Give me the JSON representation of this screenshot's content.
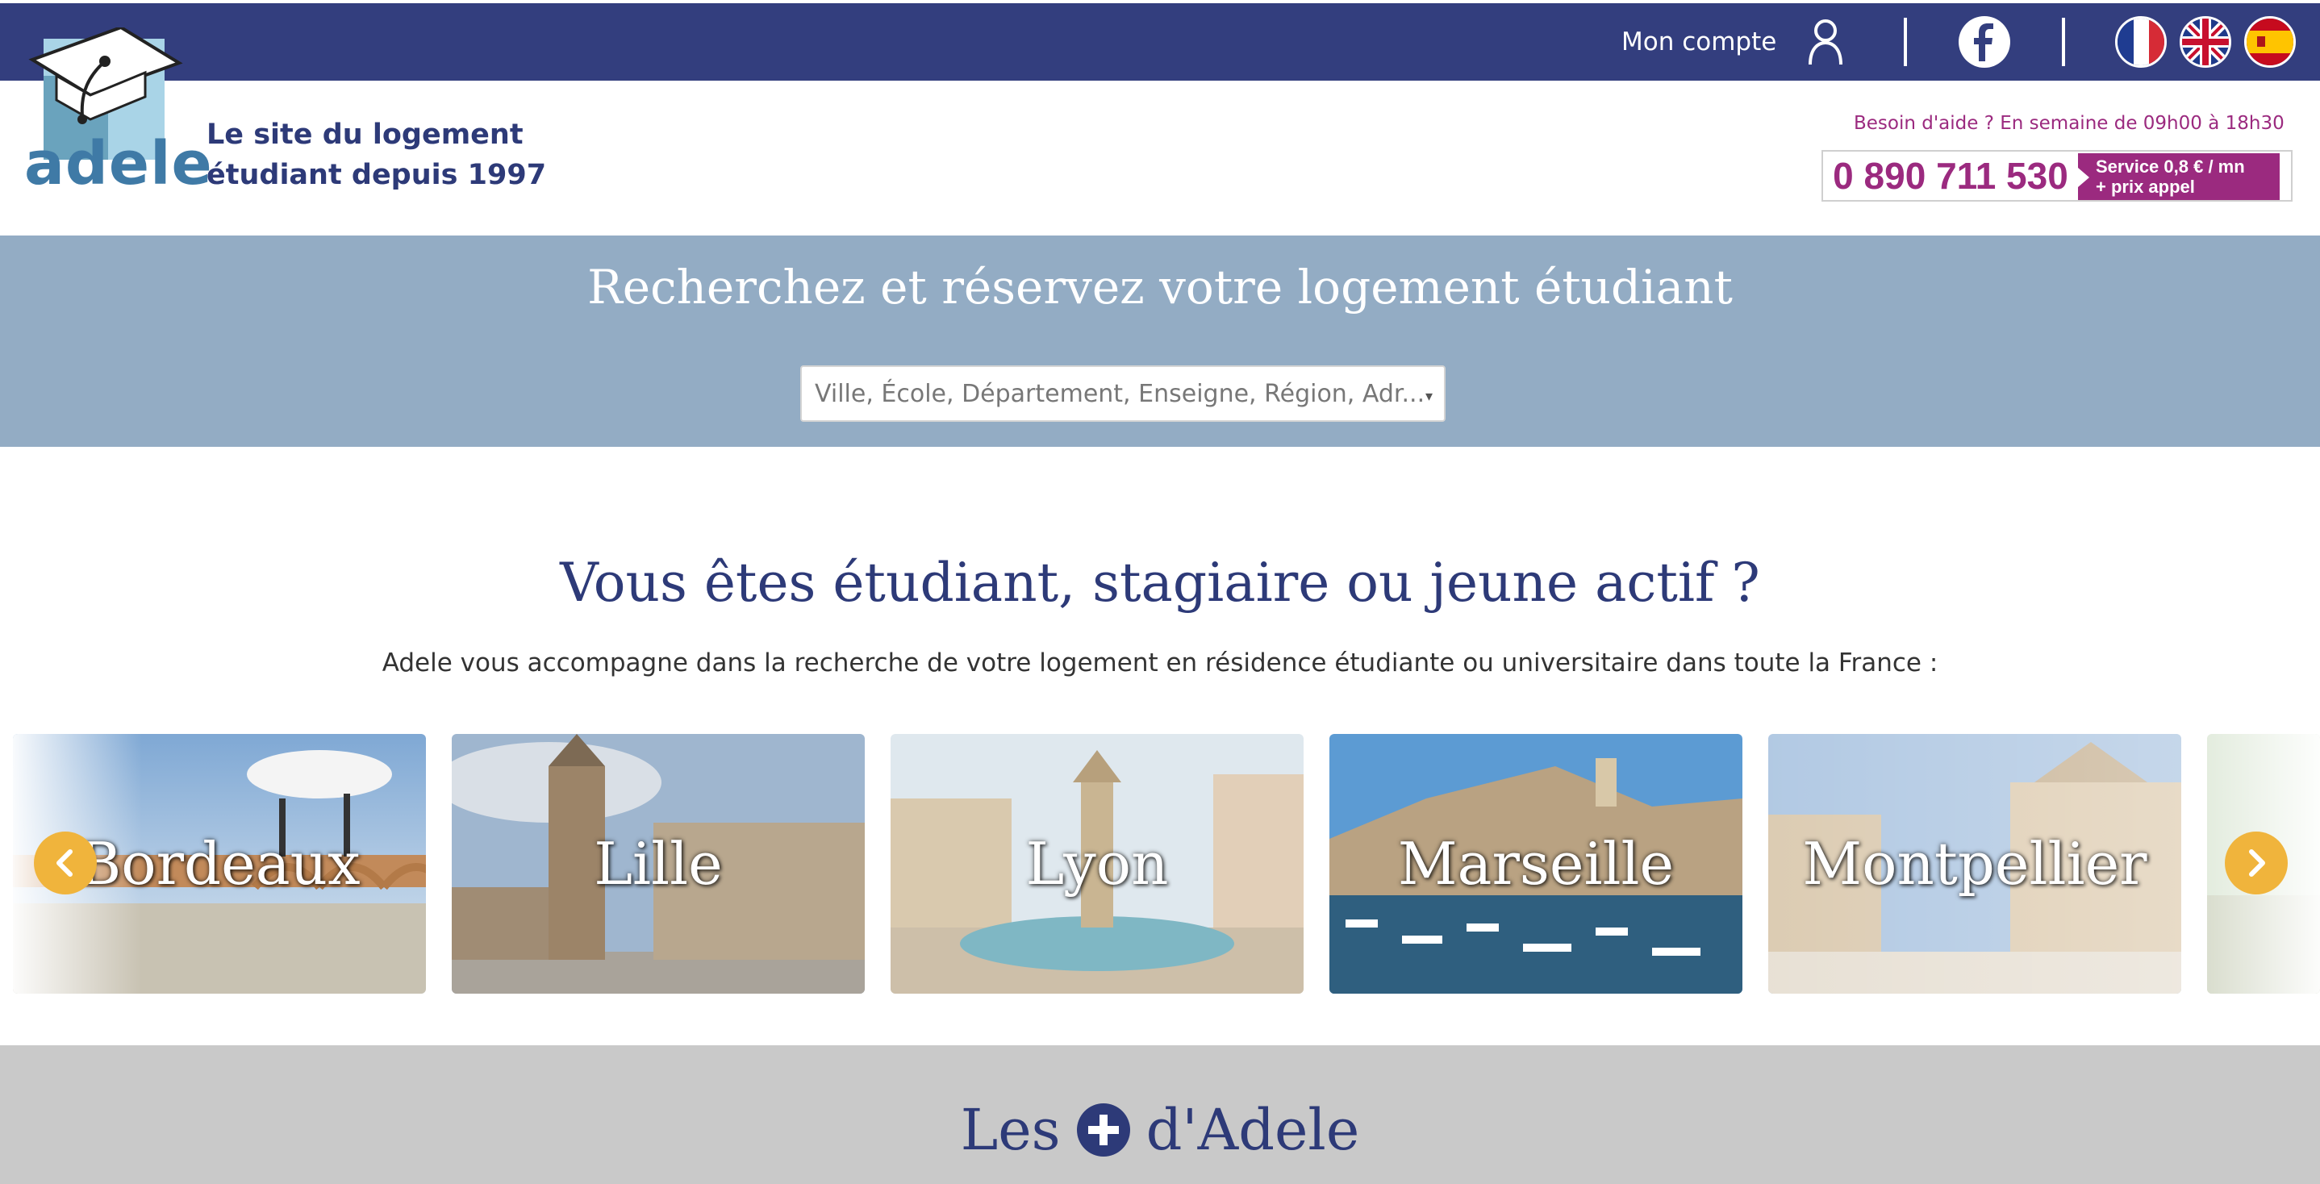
{
  "topbar": {
    "account_label": "Mon compte",
    "icons": [
      "user-icon",
      "facebook-icon",
      "flag-fr-icon",
      "flag-uk-icon",
      "flag-es-icon"
    ],
    "colors": {
      "bar": "#333e7e"
    }
  },
  "header": {
    "logo_text": "adele",
    "tagline_line1": "Le site du logement",
    "tagline_line2": "étudiant depuis 1997",
    "help_text": "Besoin d'aide ? En semaine de 09h00 à 18h30",
    "phone_number": "0 890 711 530",
    "phone_tag_line1": "Service   0,8 € / mn",
    "phone_tag_line2": "+ prix appel",
    "colors": {
      "brand": "#2d3a78",
      "phone": "#9b2a7f"
    }
  },
  "search": {
    "title": "Recherchez et réservez votre logement étudiant",
    "placeholder": "Ville, École, Département, Enseigne, Région, Adr...",
    "caret": "▾"
  },
  "intro": {
    "title": "Vous êtes étudiant, stagiaire ou jeune actif ?",
    "text": "Adele vous accompagne dans la recherche de votre logement en résidence étudiante ou universitaire dans toute la France :"
  },
  "carousel": {
    "cities": [
      "Bordeaux",
      "Lille",
      "Lyon",
      "Marseille",
      "Montpellier"
    ],
    "prev_icon": "chevron-left-icon",
    "next_icon": "chevron-right-icon",
    "accent": "#f0b43c"
  },
  "plus": {
    "prefix": "Les",
    "suffix": "d'Adele",
    "icon": "plus-circle-icon"
  }
}
